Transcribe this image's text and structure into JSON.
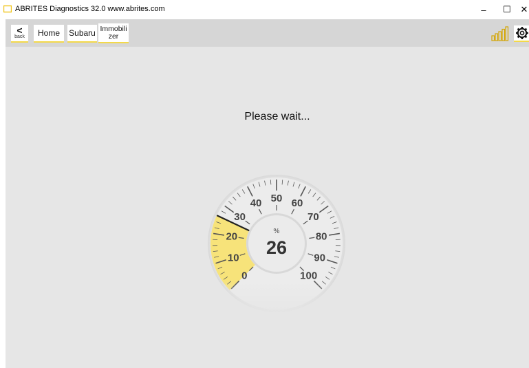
{
  "window": {
    "title": "ABRITES Diagnostics 32.0   www.abrites.com",
    "minimize_glyph": "–",
    "maximize_glyph": "☐",
    "close_glyph": "✕"
  },
  "toolbar": {
    "back_label": "back",
    "back_arrow": "<",
    "breadcrumbs": [
      "Home",
      "Subaru",
      "Immobilizer"
    ],
    "signal_icon": "signal-bars-icon",
    "settings_icon": "gear-icon",
    "accent_color": "#f3d94a"
  },
  "main": {
    "status_text": "Please wait..."
  },
  "gauge": {
    "unit": "%",
    "value": 26,
    "min": 0,
    "max": 100,
    "tick_labels": [
      "0",
      "10",
      "20",
      "30",
      "40",
      "50",
      "60",
      "70",
      "80",
      "90",
      "100"
    ],
    "fill_color": "#f7e37a",
    "needle_color": "#222222"
  }
}
